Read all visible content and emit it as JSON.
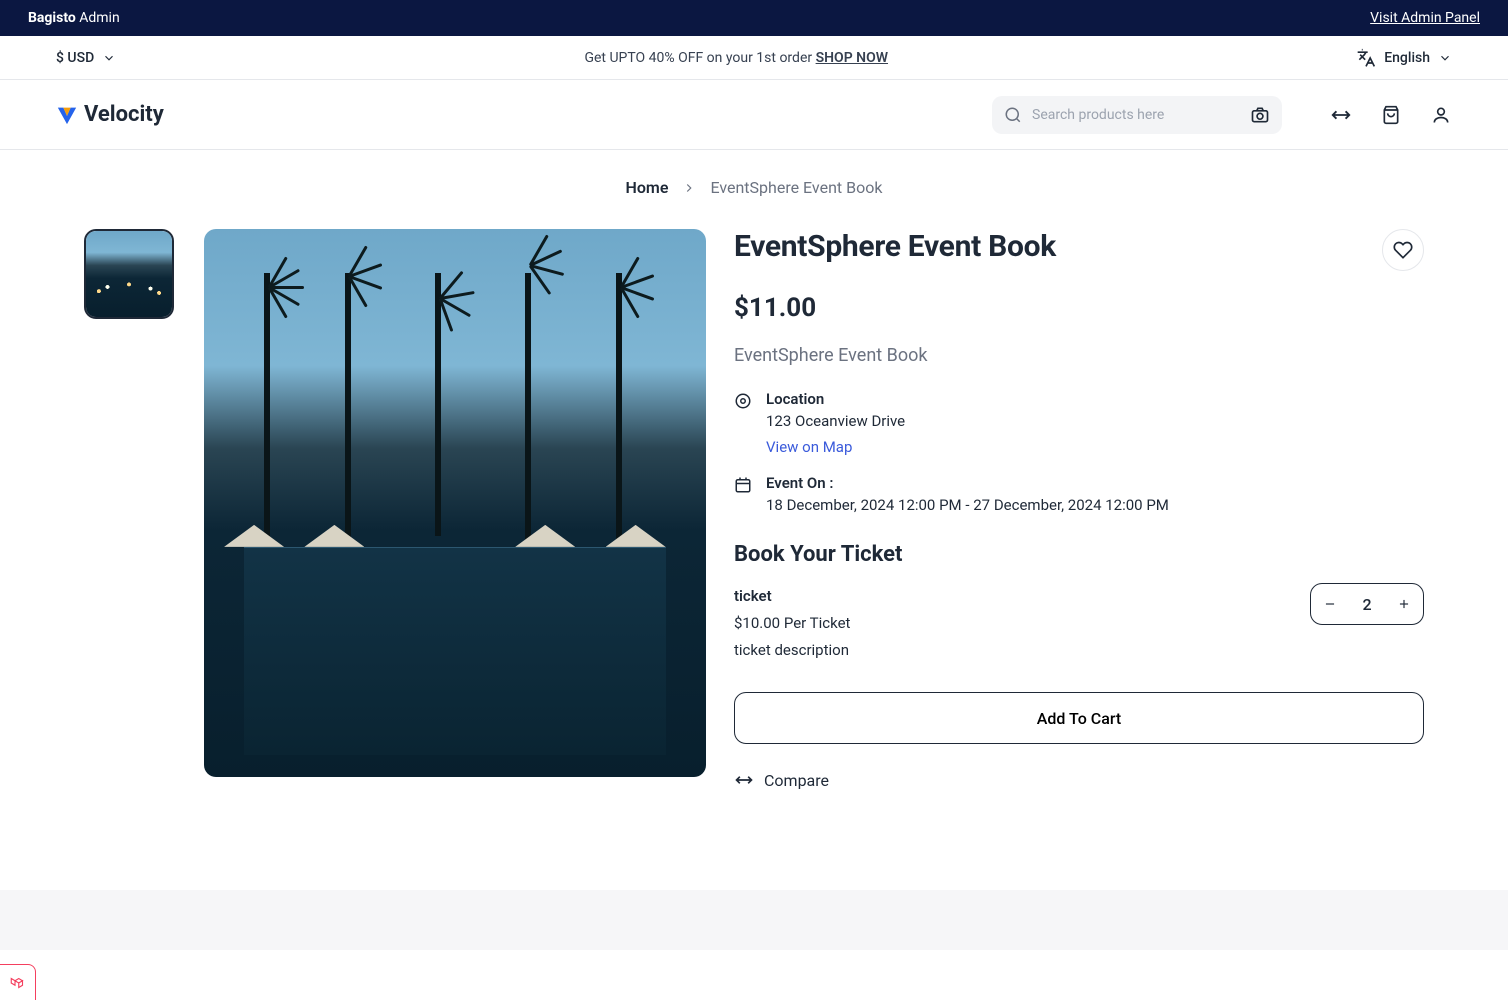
{
  "admin": {
    "brand_bold": "Bagisto",
    "brand_rest": " Admin",
    "visit": "Visit Admin Panel"
  },
  "promo": {
    "currency": "$ USD",
    "text_prefix": "Get UPTO 40% OFF on your 1st order ",
    "text_link": "SHOP NOW",
    "language": "English"
  },
  "header": {
    "logo": "Velocity",
    "search_placeholder": "Search products here"
  },
  "breadcrumb": {
    "home": "Home",
    "current": "EventSphere Event Book"
  },
  "product": {
    "title": "EventSphere Event Book",
    "price": "$11.00",
    "subtitle": "EventSphere Event Book",
    "location_label": "Location",
    "location_value": "123 Oceanview Drive",
    "map_link": "View on Map",
    "event_label": "Event On :",
    "event_value": "18 December, 2024 12:00 PM - 27 December, 2024 12:00 PM",
    "book_heading": "Book Your Ticket",
    "ticket_name": "ticket",
    "ticket_price": "$10.00 Per Ticket",
    "ticket_desc": "ticket description",
    "quantity": "2",
    "add_to_cart": "Add To Cart",
    "compare": "Compare"
  }
}
